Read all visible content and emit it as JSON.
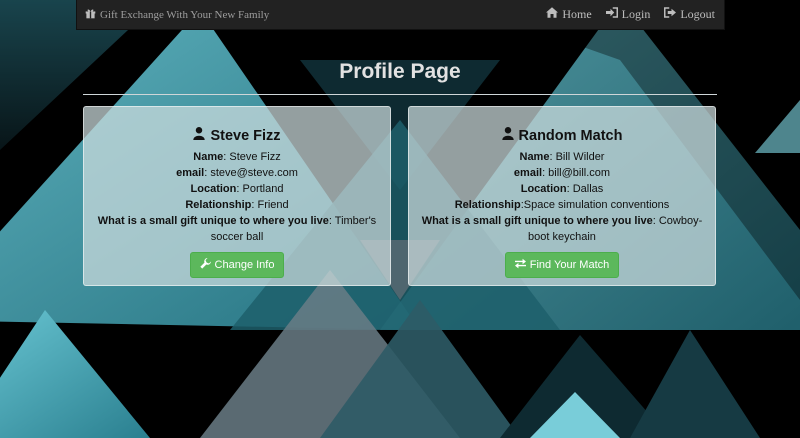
{
  "navbar": {
    "brand": "Gift Exchange With Your New Family",
    "brand_icon": "gift-icon",
    "links": [
      {
        "label": "Home",
        "icon": "home-icon"
      },
      {
        "label": "Login",
        "icon": "login-icon"
      },
      {
        "label": "Logout",
        "icon": "logout-icon"
      }
    ]
  },
  "page": {
    "title": "Profile Page"
  },
  "profile": {
    "heading": "Steve Fizz",
    "name_label": "Name",
    "name_value": ": Steve Fizz",
    "email_label": "email",
    "email_value": ": steve@steve.com",
    "location_label": "Location",
    "location_value": ": Portland",
    "relationship_label": "Relationship",
    "relationship_value": ": Friend",
    "gift_label": "What is a small gift unique to where you live",
    "gift_value_1": ": Timber's",
    "gift_value_2": "soccer ball",
    "button": "Change Info"
  },
  "match": {
    "heading": "Random Match",
    "name_label": "Name",
    "name_value": ": Bill Wilder",
    "email_label": "email",
    "email_value": ": bill@bill.com",
    "location_label": "Location",
    "location_value": ": Dallas",
    "relationship_label": "Relationship",
    "relationship_value": ":Space simulation conventions",
    "gift_label": "What is a small gift unique to where you live",
    "gift_value_1": ": Cowboy-",
    "gift_value_2": "boot keychain",
    "button": "Find Your Match"
  },
  "colors": {
    "accent": "#5cb85c",
    "navbar": "#222222",
    "teal": "#4fb6c6"
  }
}
